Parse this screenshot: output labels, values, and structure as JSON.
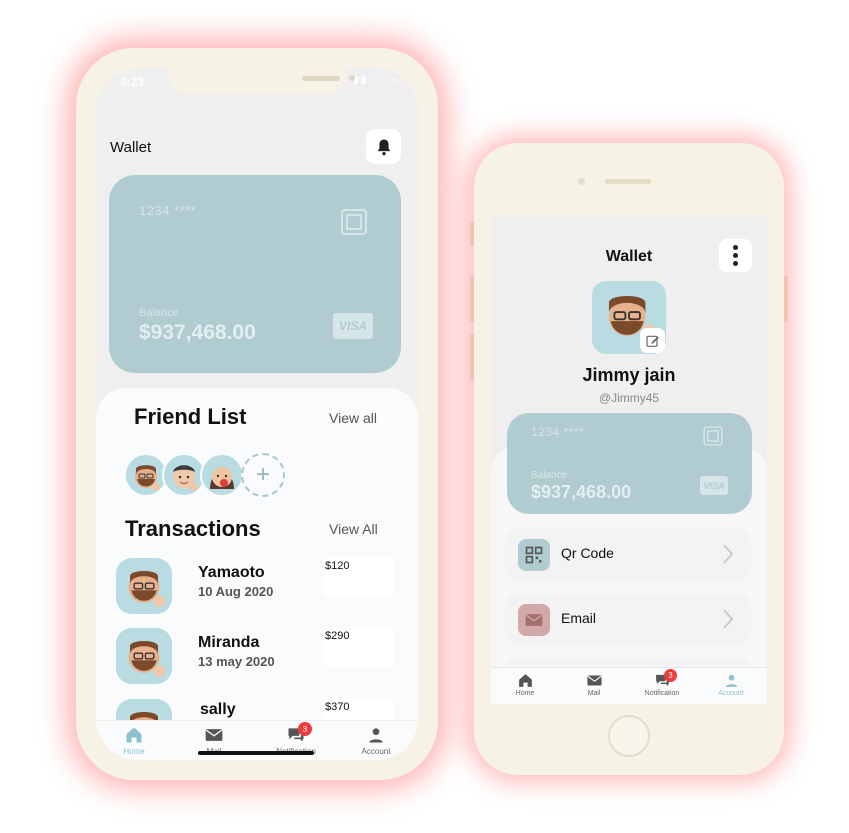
{
  "left_phone": {
    "status_time": "4:23",
    "title": "Wallet",
    "card": {
      "number": "1234 ****",
      "balance_label": "Balance",
      "balance": "$937,468.00",
      "network": "VISA"
    },
    "friends": {
      "title": "Friend List",
      "link": "View all",
      "add_symbol": "+"
    },
    "transactions": {
      "title": "Transactions",
      "link": "View All",
      "rows": [
        {
          "name": "Yamaoto",
          "date": "10 Aug 2020",
          "amount": "$120"
        },
        {
          "name": "Miranda",
          "date": "13 may 2020",
          "amount": "$290"
        },
        {
          "name": "sally",
          "date": "",
          "amount": "$370"
        }
      ]
    },
    "tabs": [
      {
        "label": "Home",
        "icon": "home-icon",
        "active": true
      },
      {
        "label": "Mail",
        "icon": "mail-icon"
      },
      {
        "label": "Notification",
        "icon": "chat-icon",
        "badge": "3"
      },
      {
        "label": "Account",
        "icon": "person-icon"
      }
    ]
  },
  "right_phone": {
    "title": "Wallet",
    "profile": {
      "name": "Jimmy jain",
      "handle": "@Jimmy45"
    },
    "card": {
      "number": "1234 ****",
      "balance_label": "Balance",
      "balance": "$937,468.00",
      "network": "VISA"
    },
    "menu": [
      {
        "label": "Qr Code",
        "icon": "qr-code-icon"
      },
      {
        "label": "Email",
        "icon": "envelope-icon"
      }
    ],
    "tabs": [
      {
        "label": "Home",
        "icon": "home-icon"
      },
      {
        "label": "Mail",
        "icon": "mail-icon"
      },
      {
        "label": "Notification",
        "icon": "chat-icon",
        "badge": "3"
      },
      {
        "label": "Account",
        "icon": "person-icon",
        "active": true
      }
    ]
  },
  "colors": {
    "card": "#b0ccd0",
    "accent": "#8cc1cd",
    "badge": "#ef3b3b",
    "phone_frame": "#f6f3e6",
    "glow": "#ff5a5a"
  }
}
